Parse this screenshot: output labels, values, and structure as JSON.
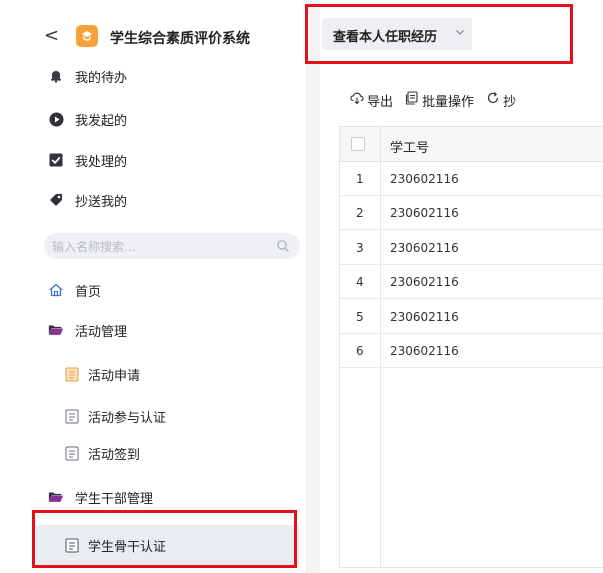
{
  "app": {
    "title": "学生综合素质评价系统"
  },
  "nav": {
    "top_items": [
      {
        "label": "我的待办",
        "icon": "bell-icon"
      },
      {
        "label": "我发起的",
        "icon": "play-circle-icon"
      },
      {
        "label": "我处理的",
        "icon": "checkbox-icon"
      },
      {
        "label": "抄送我的",
        "icon": "tag-icon"
      }
    ],
    "search_placeholder": "输入名称搜索...",
    "menu": {
      "home": "首页",
      "activity_group": "活动管理",
      "activity_items": [
        "活动申请",
        "活动参与认证",
        "活动签到"
      ],
      "cadre_group": "学生干部管理",
      "cadre_items": [
        "学生骨干认证"
      ]
    }
  },
  "header": {
    "dropdown_label": "查看本人任职经历"
  },
  "toolbar": {
    "export": "导出",
    "batch": "批量操作",
    "third": "抄"
  },
  "table": {
    "columns": [
      "学工号"
    ],
    "rows": [
      {
        "idx": "1",
        "id": "230602116"
      },
      {
        "idx": "2",
        "id": "230602116"
      },
      {
        "idx": "3",
        "id": "230602116"
      },
      {
        "idx": "4",
        "id": "230602116"
      },
      {
        "idx": "5",
        "id": "230602116"
      },
      {
        "idx": "6",
        "id": "230602116"
      }
    ]
  },
  "colors": {
    "accent_orange": "#f7a23a",
    "highlight_red": "#e4101a",
    "folder": "#8a2f96"
  }
}
